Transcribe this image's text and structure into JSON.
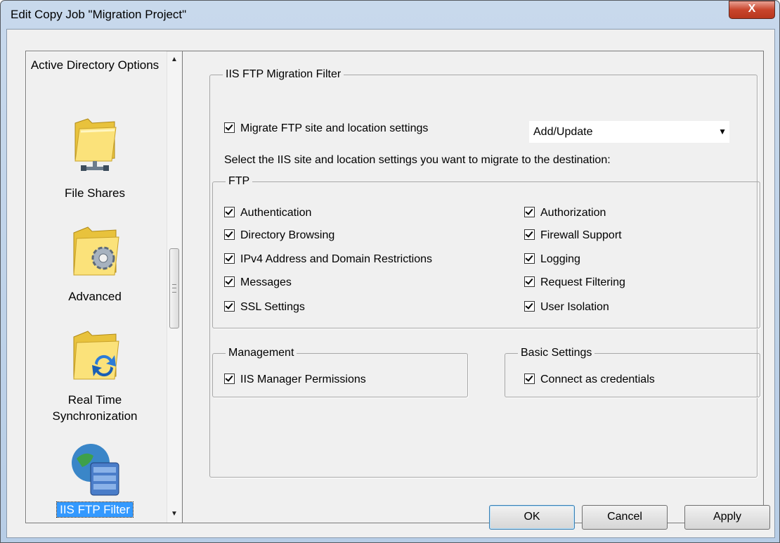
{
  "window": {
    "title": "Edit Copy Job \"Migration Project\"",
    "close_label": "X"
  },
  "nav": {
    "items": [
      {
        "label": "Active Directory Options"
      },
      {
        "label": "File Shares"
      },
      {
        "label": "Advanced"
      },
      {
        "label": "Real Time Synchronization"
      },
      {
        "label": "IIS FTP Filter",
        "selected": true
      }
    ]
  },
  "panel": {
    "group_title": "IIS FTP Migration Filter",
    "migrate_checkbox": {
      "label": "Migrate FTP site and location settings",
      "checked": true
    },
    "mode_dropdown": {
      "value": "Add/Update"
    },
    "description": "Select the IIS site and location settings you want to migrate to the destination:",
    "ftp": {
      "title": "FTP",
      "left": [
        {
          "label": "Authentication",
          "checked": true
        },
        {
          "label": "Directory Browsing",
          "checked": true
        },
        {
          "label": "IPv4 Address and Domain Restrictions",
          "checked": true
        },
        {
          "label": "Messages",
          "checked": true
        },
        {
          "label": "SSL Settings",
          "checked": true
        }
      ],
      "right": [
        {
          "label": "Authorization",
          "checked": true
        },
        {
          "label": "Firewall Support",
          "checked": true
        },
        {
          "label": "Logging",
          "checked": true
        },
        {
          "label": "Request Filtering",
          "checked": true
        },
        {
          "label": "User Isolation",
          "checked": true
        }
      ]
    },
    "management": {
      "title": "Management",
      "item": {
        "label": "IIS Manager Permissions",
        "checked": true
      }
    },
    "basic": {
      "title": "Basic Settings",
      "item": {
        "label": "Connect as credentials",
        "checked": true
      }
    }
  },
  "buttons": {
    "ok": "OK",
    "cancel": "Cancel",
    "apply": "Apply"
  }
}
